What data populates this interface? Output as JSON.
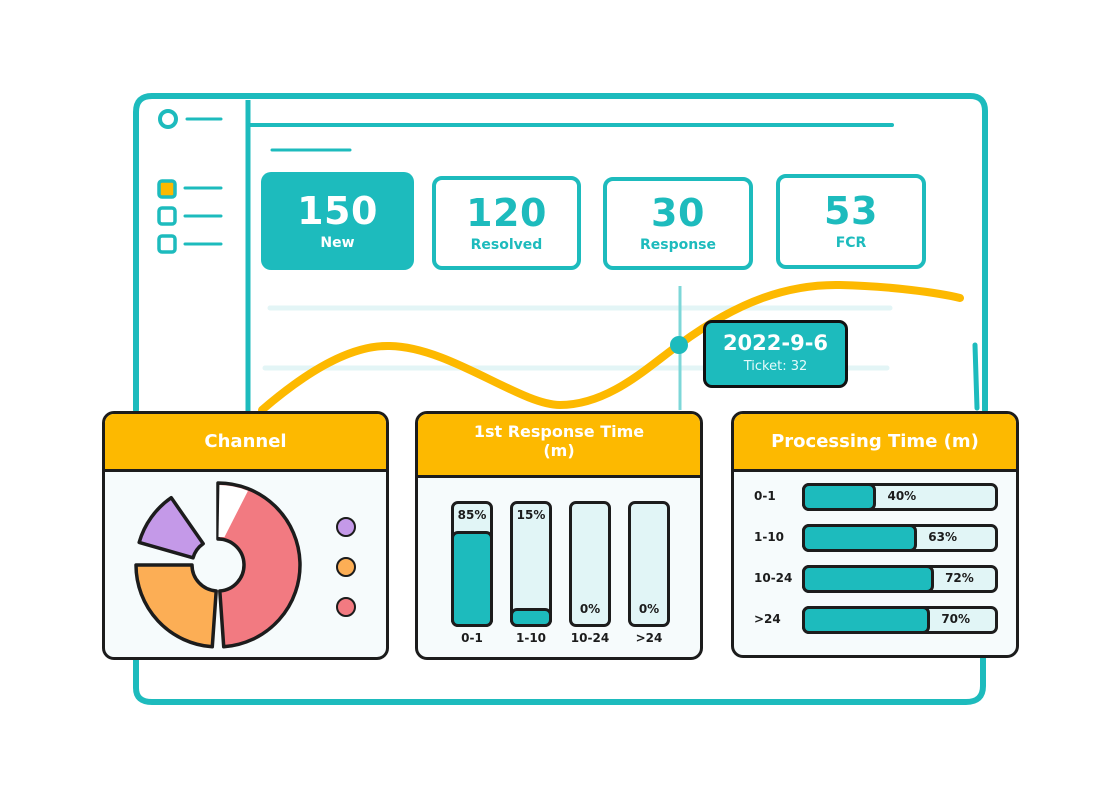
{
  "colors": {
    "teal": "#1dbbbd",
    "yellow": "#fdb900",
    "outline": "#1c1c1c",
    "purple": "#c499e8",
    "orange": "#fcae55",
    "red": "#f27a81",
    "light_teal": "#e1f5f6"
  },
  "sidebar": {
    "items": [
      {
        "icon": "circle-icon",
        "active": false
      },
      {
        "icon": "checkbox-icon",
        "active": true
      },
      {
        "icon": "checkbox-icon",
        "active": false
      },
      {
        "icon": "checkbox-icon",
        "active": false
      }
    ]
  },
  "kpis": [
    {
      "value": "150",
      "label": "New",
      "style": "filled"
    },
    {
      "value": "120",
      "label": "Resolved",
      "style": "outline"
    },
    {
      "value": "30",
      "label": "Response",
      "style": "outline"
    },
    {
      "value": "53",
      "label": "FCR",
      "style": "outline"
    }
  ],
  "trend": {
    "tooltip": {
      "date": "2022-9-6",
      "ticket": "Ticket: 32"
    }
  },
  "channel_card": {
    "title": "Channel",
    "legend": [
      {
        "color": "#c499e8",
        "name": "purple"
      },
      {
        "color": "#fcae55",
        "name": "orange"
      },
      {
        "color": "#f27a81",
        "name": "red"
      }
    ]
  },
  "response_card": {
    "title": "1st Response Time (m)"
  },
  "processing_card": {
    "title": "Processing Time (m)"
  },
  "chart_data": [
    {
      "type": "pie",
      "title": "Channel",
      "slices": [
        {
          "name": "red",
          "value": 50,
          "color": "#f27a81"
        },
        {
          "name": "orange",
          "value": 25,
          "color": "#fcae55"
        },
        {
          "name": "purple",
          "value": 12,
          "color": "#c499e8"
        }
      ]
    },
    {
      "type": "bar",
      "title": "1st Response Time (m)",
      "categories": [
        "0-1",
        "1-10",
        "10-24",
        ">24"
      ],
      "values": [
        85,
        15,
        0,
        0
      ],
      "value_labels": [
        "85%",
        "15%",
        "0%",
        "0%"
      ],
      "ylim": [
        0,
        100
      ]
    },
    {
      "type": "bar",
      "orientation": "horizontal",
      "title": "Processing Time (m)",
      "categories": [
        "0-1",
        "1-10",
        "10-24",
        ">24"
      ],
      "values": [
        40,
        63,
        72,
        70
      ],
      "value_labels": [
        "40%",
        "63%",
        "72%",
        "70%"
      ],
      "xlim": [
        0,
        100
      ]
    }
  ]
}
